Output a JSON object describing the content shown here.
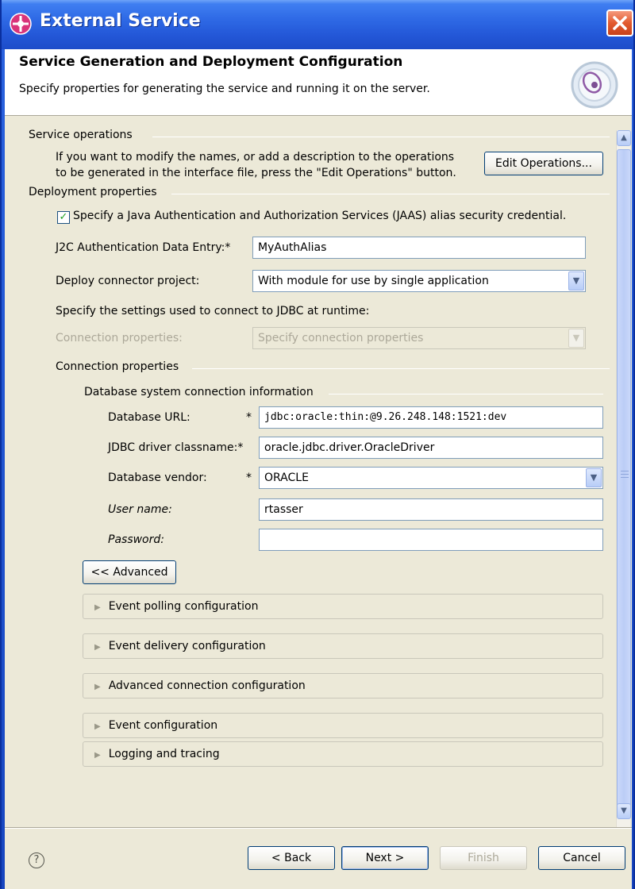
{
  "window": {
    "title": "External Service",
    "close_label": "✕"
  },
  "header": {
    "title": "Service Generation and Deployment Configuration",
    "description": "Specify properties for generating the service and running it on the server."
  },
  "service_operations": {
    "group_label": "Service operations",
    "text_line1": "If you want to modify the names, or add a description to the operations",
    "text_line2": "to be generated in the interface file, press the \"Edit Operations\" button.",
    "edit_button": "Edit Operations..."
  },
  "deployment": {
    "group_label": "Deployment properties",
    "jaas_checkbox_label": "Specify a Java Authentication and Authorization Services (JAAS) alias security credential.",
    "jaas_checked": true,
    "j2c_label": "J2C Authentication Data Entry:",
    "j2c_value": "MyAuthAlias",
    "deploy_label": "Deploy connector project:",
    "deploy_value": "With module for use by single application",
    "jdbc_runtime_text": "Specify the settings used to connect to JDBC at runtime:",
    "conn_props_label": "Connection properties:",
    "conn_props_value": "Specify connection properties"
  },
  "connection_properties": {
    "group_label": "Connection properties",
    "db_group_label": "Database system connection information",
    "db_url_label": "Database URL:",
    "db_url_value": "jdbc:oracle:thin:@9.26.248.148:1521:dev",
    "driver_label": "JDBC driver classname:",
    "driver_value": "oracle.jdbc.driver.OracleDriver",
    "vendor_label": "Database vendor:",
    "vendor_value": "ORACLE",
    "user_label": "User name:",
    "user_value": "rtasser",
    "password_label": "Password:",
    "password_value": "",
    "required_marker": "*"
  },
  "advanced_button": "<< Advanced",
  "sections": [
    "Event polling configuration",
    "Event delivery configuration",
    "Advanced connection configuration",
    "Event configuration",
    "Logging and tracing"
  ],
  "footer": {
    "help": "?",
    "back": "< Back",
    "next": "Next >",
    "finish": "Finish",
    "cancel": "Cancel"
  }
}
